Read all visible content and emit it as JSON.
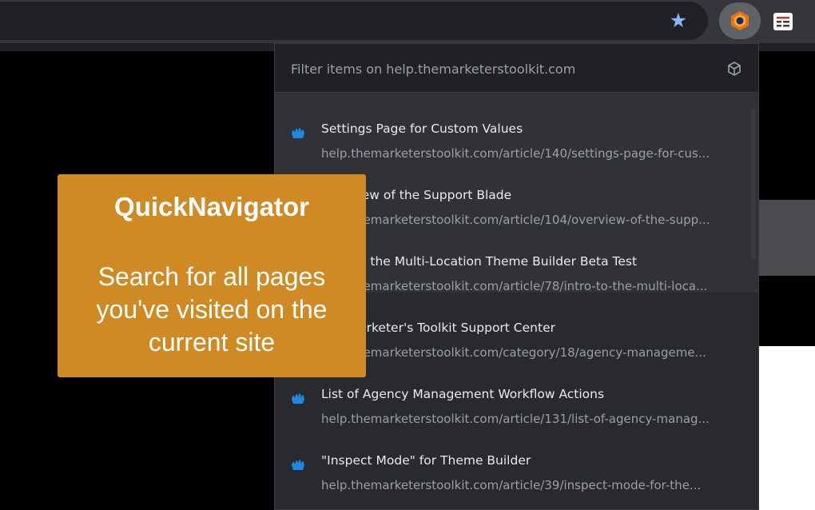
{
  "toolbar": {
    "bookmark_icon": "star-icon",
    "extension_icon": "quicknavigator-extension-icon",
    "menu_icon": "reading-list-icon",
    "accent": "#8ab4f8"
  },
  "popup": {
    "filter_placeholder": "Filter items on help.themarketerstoolkit.com",
    "items": [
      {
        "title": "Settings Page for Custom Values",
        "url": "help.themarketerstoolkit.com/article/140/settings-page-for-cus..."
      },
      {
        "title": "Overview of the Support Blade",
        "url": "help.themarketerstoolkit.com/article/104/overview-of-the-supp..."
      },
      {
        "title": "Intro to the Multi-Location Theme Builder Beta Test",
        "url": "help.themarketerstoolkit.com/article/78/intro-to-the-multi-loca..."
      },
      {
        "title": "The Marketer's Toolkit Support Center",
        "url": "help.themarketerstoolkit.com/category/18/agency-manageme..."
      },
      {
        "title": "List of Agency Management Workflow Actions",
        "url": "help.themarketerstoolkit.com/article/131/list-of-agency-manag..."
      },
      {
        "title": "\"Inspect Mode\" for Theme Builder",
        "url": "help.themarketerstoolkit.com/article/39/inspect-mode-for-the..."
      }
    ]
  },
  "promo": {
    "title": "QuickNavigator",
    "description": "Search for all pages you've visited on the current site",
    "color": "#d08a23"
  }
}
